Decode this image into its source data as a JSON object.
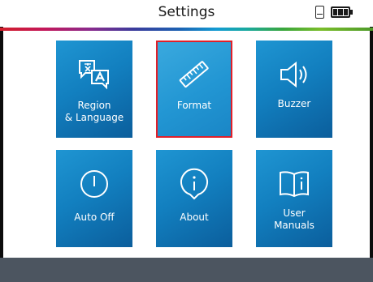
{
  "header": {
    "title": "Settings"
  },
  "status": {
    "storage_icon": "sd-card-icon",
    "battery_icon": "battery-icon",
    "battery_level": 1.0
  },
  "tiles": [
    {
      "label": "Region\n& Language",
      "icon": "translate-icon",
      "selected": false
    },
    {
      "label": "Format",
      "icon": "ruler-icon",
      "selected": true
    },
    {
      "label": "Buzzer",
      "icon": "speaker-icon",
      "selected": false
    },
    {
      "label": "Auto Off",
      "icon": "power-icon",
      "selected": false
    },
    {
      "label": "About",
      "icon": "info-icon",
      "selected": false
    },
    {
      "label": "User\nManuals",
      "icon": "manual-icon",
      "selected": false
    }
  ],
  "colors": {
    "tile": "#127fbf",
    "selected_border": "#e0202a",
    "footer": "#4c5560"
  }
}
